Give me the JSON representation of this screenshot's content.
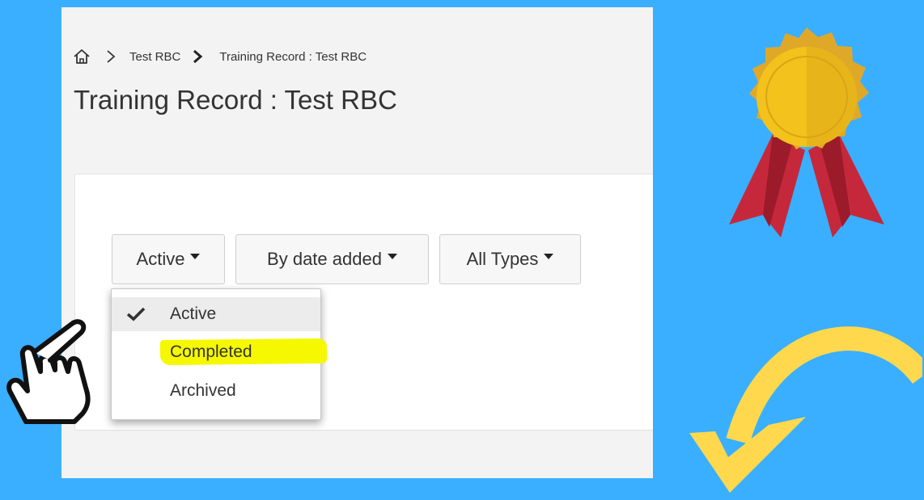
{
  "breadcrumb": {
    "home_icon": "home-icon",
    "items": [
      "Test RBC",
      "Training Record : Test RBC"
    ]
  },
  "page": {
    "title": "Training Record : Test RBC"
  },
  "filters": {
    "status": {
      "label": "Active"
    },
    "sort": {
      "label": "By date added"
    },
    "types": {
      "label": "All Types"
    }
  },
  "status_menu": {
    "items": [
      {
        "label": "Active",
        "selected": true
      },
      {
        "label": "Completed",
        "highlighted": true
      },
      {
        "label": "Archived"
      }
    ],
    "check_icon": "checkmark-icon"
  },
  "decorations": {
    "pointer": "pointing-hand-icon",
    "badge": "award-ribbon-icon",
    "arrow": "curved-arrow-icon",
    "highlight_color": "#f5f800",
    "background_color": "#3aafff"
  }
}
